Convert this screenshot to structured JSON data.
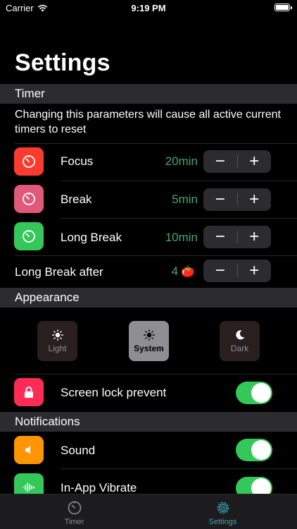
{
  "status": {
    "carrier": "Carrier",
    "time": "9:19 PM"
  },
  "title": "Settings",
  "sections": {
    "timer": "Timer",
    "appearance": "Appearance",
    "notifications": "Notifications"
  },
  "timer_note": "Changing this parameters will cause all active current timers to reset",
  "timers": [
    {
      "label": "Focus",
      "value": "20min",
      "color": "#ff3b30"
    },
    {
      "label": "Break",
      "value": "5min",
      "color": "#e0587a"
    },
    {
      "label": "Long Break",
      "value": "10min",
      "color": "#34c759"
    }
  ],
  "long_break_after": {
    "label": "Long Break after",
    "value": "4",
    "emoji": "🍅"
  },
  "stepper": {
    "minus": "−",
    "plus": "+"
  },
  "appearance": [
    {
      "label": "Light",
      "selected": false
    },
    {
      "label": "System",
      "selected": true
    },
    {
      "label": "Dark",
      "selected": false
    }
  ],
  "screen_lock": {
    "label": "Screen lock prevent",
    "on": true,
    "color": "#ff2d55"
  },
  "notifications": [
    {
      "label": "Sound",
      "on": true,
      "color": "#ff9500"
    },
    {
      "label": "In-App Vibrate",
      "on": true,
      "color": "#34c759"
    }
  ],
  "tabs": [
    {
      "label": "Timer",
      "active": false
    },
    {
      "label": "Settings",
      "active": true
    }
  ],
  "accent": "#3fa87a"
}
